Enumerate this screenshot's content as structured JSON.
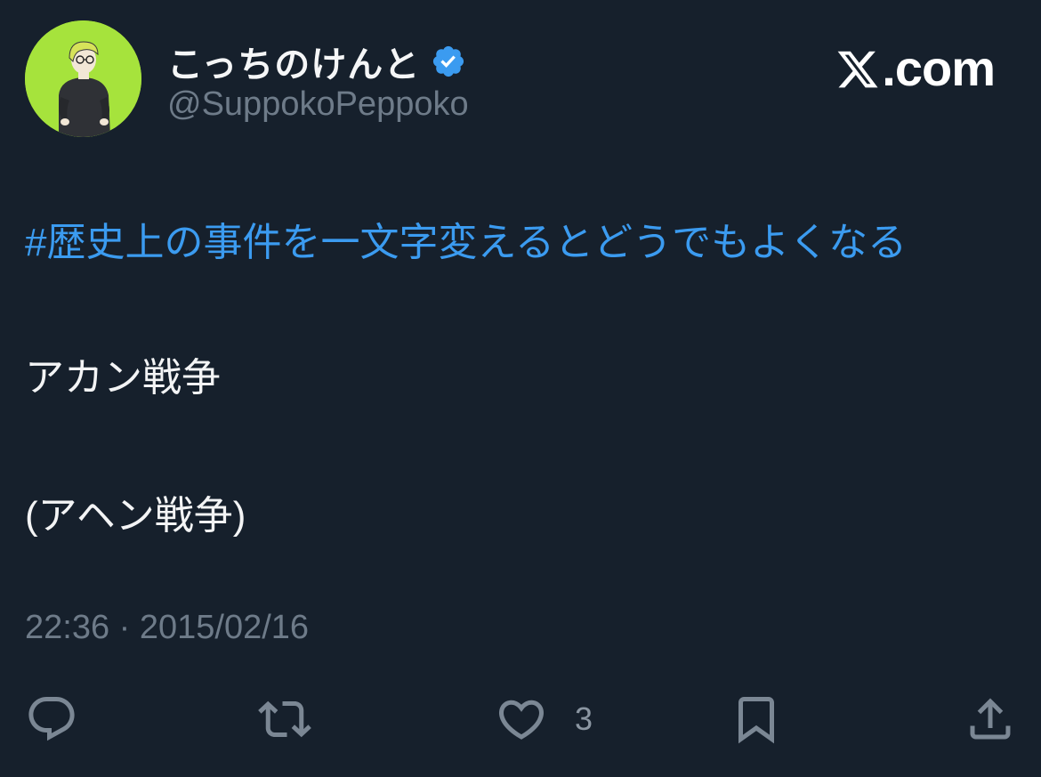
{
  "author": {
    "display_name": "こっちのけんと",
    "handle": "@SuppokoPeppoko",
    "verified": true,
    "avatar_icon": "avatar-illustration-icon",
    "avatar_bg": "#a6e33c"
  },
  "brand": {
    "icon": "x-logo-icon",
    "domain_text": ".com"
  },
  "tweet": {
    "hashtag": "#歴史上の事件を一文字変えるとどうでもよくなる",
    "line1": "アカン戦争",
    "line2": "(アヘン戦争)",
    "timestamp": "22:36 · 2015/02/16"
  },
  "actions": {
    "reply_icon": "reply-icon",
    "retweet_icon": "retweet-icon",
    "like_icon": "heart-icon",
    "like_count": "3",
    "bookmark_icon": "bookmark-icon",
    "share_icon": "share-icon"
  },
  "colors": {
    "background": "#16202c",
    "link": "#3b9bf0",
    "secondary_text": "#6e7b89",
    "verified": "#3b9bf0"
  }
}
